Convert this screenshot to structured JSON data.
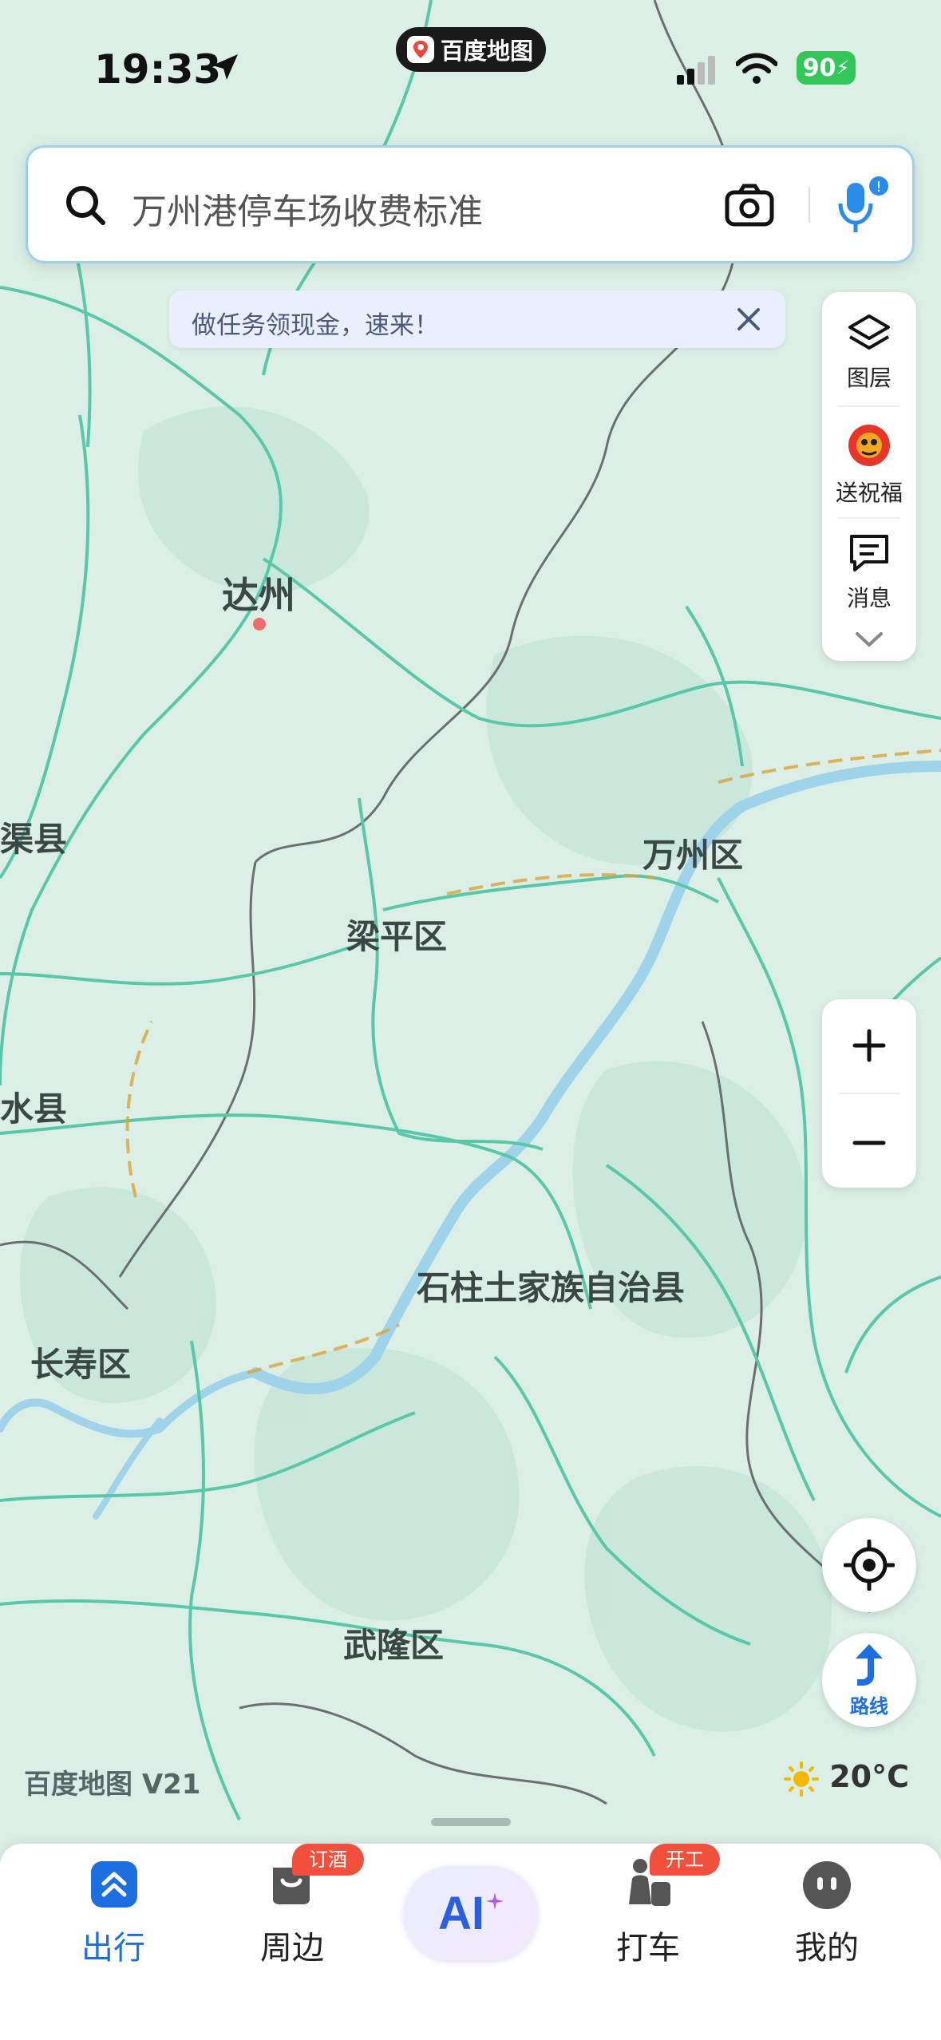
{
  "status_bar": {
    "time": "19:33",
    "app_pill": "百度地图",
    "battery": "90"
  },
  "search": {
    "placeholder": "万州港停车场收费标准"
  },
  "banner": {
    "text": "做任务领现金，速来！"
  },
  "right_panel": {
    "layers": "图层",
    "blessing": "送祝福",
    "messages": "消息"
  },
  "map": {
    "labels": {
      "dazhou": "达州",
      "qu_county": "渠县",
      "wanzhou": "万州区",
      "liangping": "梁平区",
      "linshui": "水县",
      "shizhu": "石柱土家族自治县",
      "changshou": "长寿区",
      "wulong": "武隆区"
    }
  },
  "route_button": {
    "label": "路线"
  },
  "brand": "百度地图 V21",
  "weather": {
    "temp": "20°C"
  },
  "bottom_nav": {
    "tabs": [
      {
        "label": "出行",
        "active": true
      },
      {
        "label": "周边",
        "badge": "订酒店"
      },
      {
        "label": "AI"
      },
      {
        "label": "打车",
        "badge": "开工券"
      },
      {
        "label": "我的"
      }
    ]
  },
  "colors": {
    "accent": "#1c6fe0",
    "road": "#59c7a9",
    "water": "#9ed3ea",
    "badge": "#f0503c"
  }
}
